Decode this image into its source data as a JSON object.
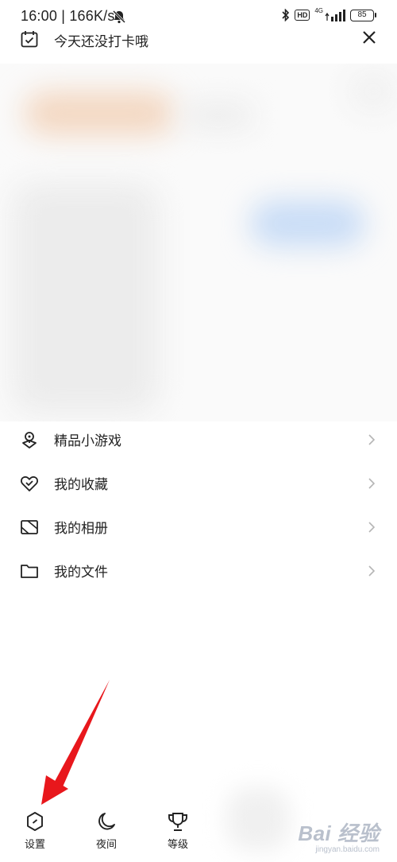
{
  "status_bar": {
    "time_speed": "16:00 | 166K/s",
    "network": "4G",
    "hd": "HD",
    "battery": "85"
  },
  "checkin": {
    "text": "今天还没打卡哦"
  },
  "menu": {
    "items": [
      {
        "label": "精品小游戏",
        "icon": "game-controller-icon"
      },
      {
        "label": "我的收藏",
        "icon": "heart-icon"
      },
      {
        "label": "我的相册",
        "icon": "album-icon"
      },
      {
        "label": "我的文件",
        "icon": "folder-icon"
      }
    ]
  },
  "bottom_bar": {
    "tabs": [
      {
        "label": "设置",
        "icon": "settings-icon"
      },
      {
        "label": "夜间",
        "icon": "moon-icon"
      },
      {
        "label": "等级",
        "icon": "trophy-icon"
      }
    ]
  },
  "watermark": {
    "main": "Bai 经验",
    "sub": "jingyan.baidu.com"
  },
  "colors": {
    "arrow": "#e8171c",
    "text": "#222222",
    "chevron": "#b5b5b5"
  }
}
